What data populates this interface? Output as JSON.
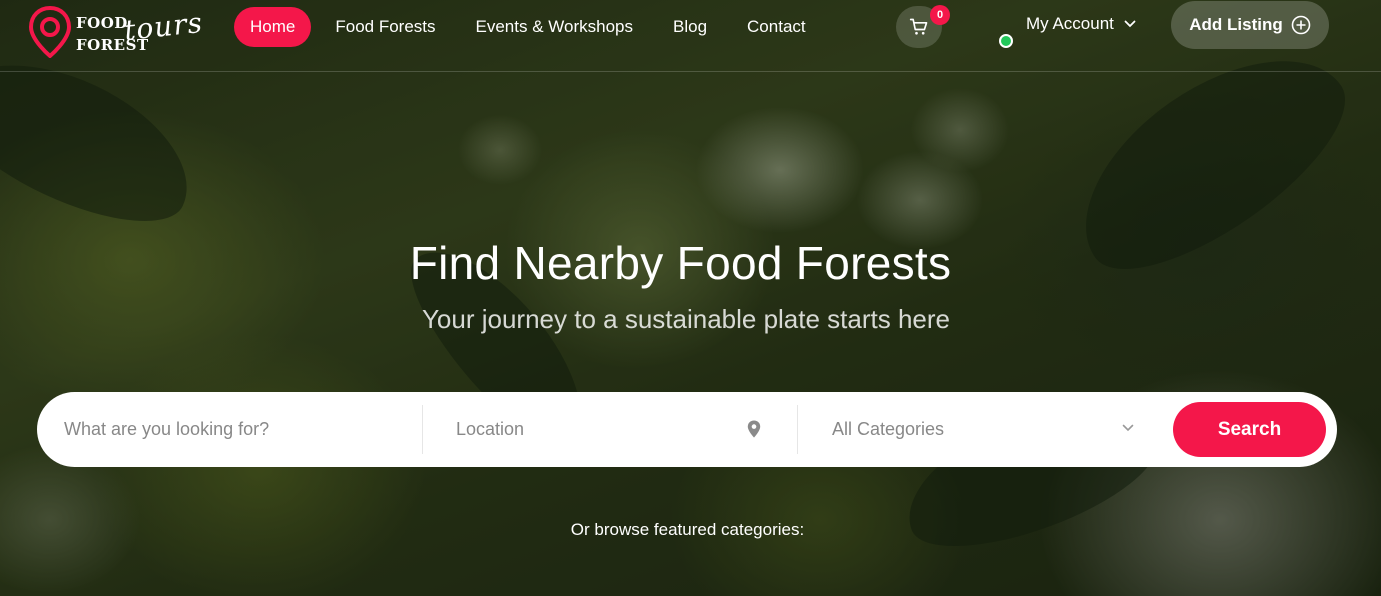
{
  "logo": {
    "line1": "FOOD",
    "line2": "FOREST",
    "script": "tours"
  },
  "nav": {
    "items": [
      {
        "label": "Home",
        "active": true
      },
      {
        "label": "Food Forests",
        "active": false
      },
      {
        "label": "Events & Workshops",
        "active": false
      },
      {
        "label": "Blog",
        "active": false
      },
      {
        "label": "Contact",
        "active": false
      }
    ]
  },
  "cart": {
    "count": "0",
    "icon": "cart-icon"
  },
  "account": {
    "label": "My Account",
    "status": "online"
  },
  "add_listing": {
    "label": "Add Listing",
    "icon": "plus-circle-icon"
  },
  "hero": {
    "title": "Find Nearby Food Forests",
    "subtitle": "Your journey to a sustainable plate starts here"
  },
  "search": {
    "what_placeholder": "What are you looking for?",
    "location_placeholder": "Location",
    "category_selected": "All Categories",
    "button_label": "Search"
  },
  "browse_label": "Or browse featured categories:",
  "colors": {
    "accent": "#f4174a",
    "status_online": "#23c85a"
  }
}
